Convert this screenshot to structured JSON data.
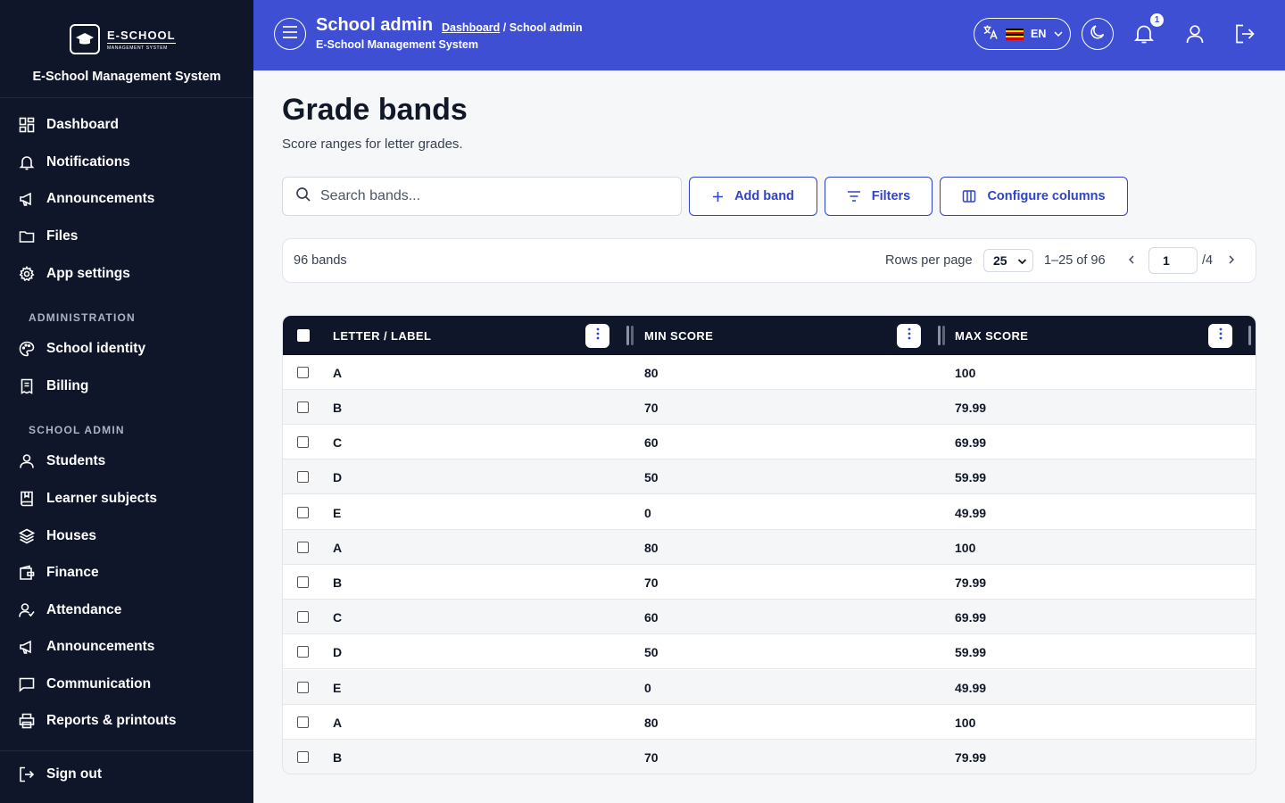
{
  "sidebar": {
    "logo": {
      "word": "E-SCHOOL",
      "tagline": "MANAGEMENT SYSTEM"
    },
    "system_name": "E-School Management System",
    "items_top": [
      {
        "label": "Dashboard",
        "icon": "dashboard-icon"
      },
      {
        "label": "Notifications",
        "icon": "bell-icon"
      },
      {
        "label": "Announcements",
        "icon": "megaphone-icon"
      },
      {
        "label": "Files",
        "icon": "folder-icon"
      },
      {
        "label": "App settings",
        "icon": "gear-icon"
      }
    ],
    "section_admin": "ADMINISTRATION",
    "items_admin": [
      {
        "label": "School identity",
        "icon": "palette-icon"
      },
      {
        "label": "Billing",
        "icon": "receipt-icon"
      }
    ],
    "section_school": "SCHOOL ADMIN",
    "items_school": [
      {
        "label": "Students",
        "icon": "user-icon"
      },
      {
        "label": "Learner subjects",
        "icon": "book-icon"
      },
      {
        "label": "Houses",
        "icon": "layers-icon"
      },
      {
        "label": "Finance",
        "icon": "wallet-icon"
      },
      {
        "label": "Attendance",
        "icon": "user-check-icon"
      },
      {
        "label": "Announcements",
        "icon": "megaphone-icon"
      },
      {
        "label": "Communication",
        "icon": "message-icon"
      },
      {
        "label": "Reports & printouts",
        "icon": "printer-icon"
      }
    ],
    "sign_out": "Sign out"
  },
  "header": {
    "title": "School admin",
    "breadcrumb_link": "Dashboard",
    "breadcrumb_rest": " / School admin",
    "subtitle": "E-School Management System",
    "language_code": "EN",
    "notification_count": "1",
    "accent_color": "#3f4fd4"
  },
  "page": {
    "title": "Grade bands",
    "subtitle": "Score ranges for letter grades."
  },
  "toolbar": {
    "search_placeholder": "Search bands...",
    "add_label": "Add band",
    "filters_label": "Filters",
    "columns_label": "Configure columns"
  },
  "pager": {
    "count_label": "96 bands",
    "rows_per_page_label": "Rows per page",
    "rows_per_page_value": "25",
    "range_label": "1–25 of 96",
    "current_page": "1",
    "total_pages_label": "/4"
  },
  "table": {
    "columns": [
      "LETTER / LABEL",
      "MIN SCORE",
      "MAX SCORE"
    ],
    "rows": [
      [
        "A",
        "80",
        "100"
      ],
      [
        "B",
        "70",
        "79.99"
      ],
      [
        "C",
        "60",
        "69.99"
      ],
      [
        "D",
        "50",
        "59.99"
      ],
      [
        "E",
        "0",
        "49.99"
      ],
      [
        "A",
        "80",
        "100"
      ],
      [
        "B",
        "70",
        "79.99"
      ],
      [
        "C",
        "60",
        "69.99"
      ],
      [
        "D",
        "50",
        "59.99"
      ],
      [
        "E",
        "0",
        "49.99"
      ],
      [
        "A",
        "80",
        "100"
      ],
      [
        "B",
        "70",
        "79.99"
      ]
    ]
  }
}
